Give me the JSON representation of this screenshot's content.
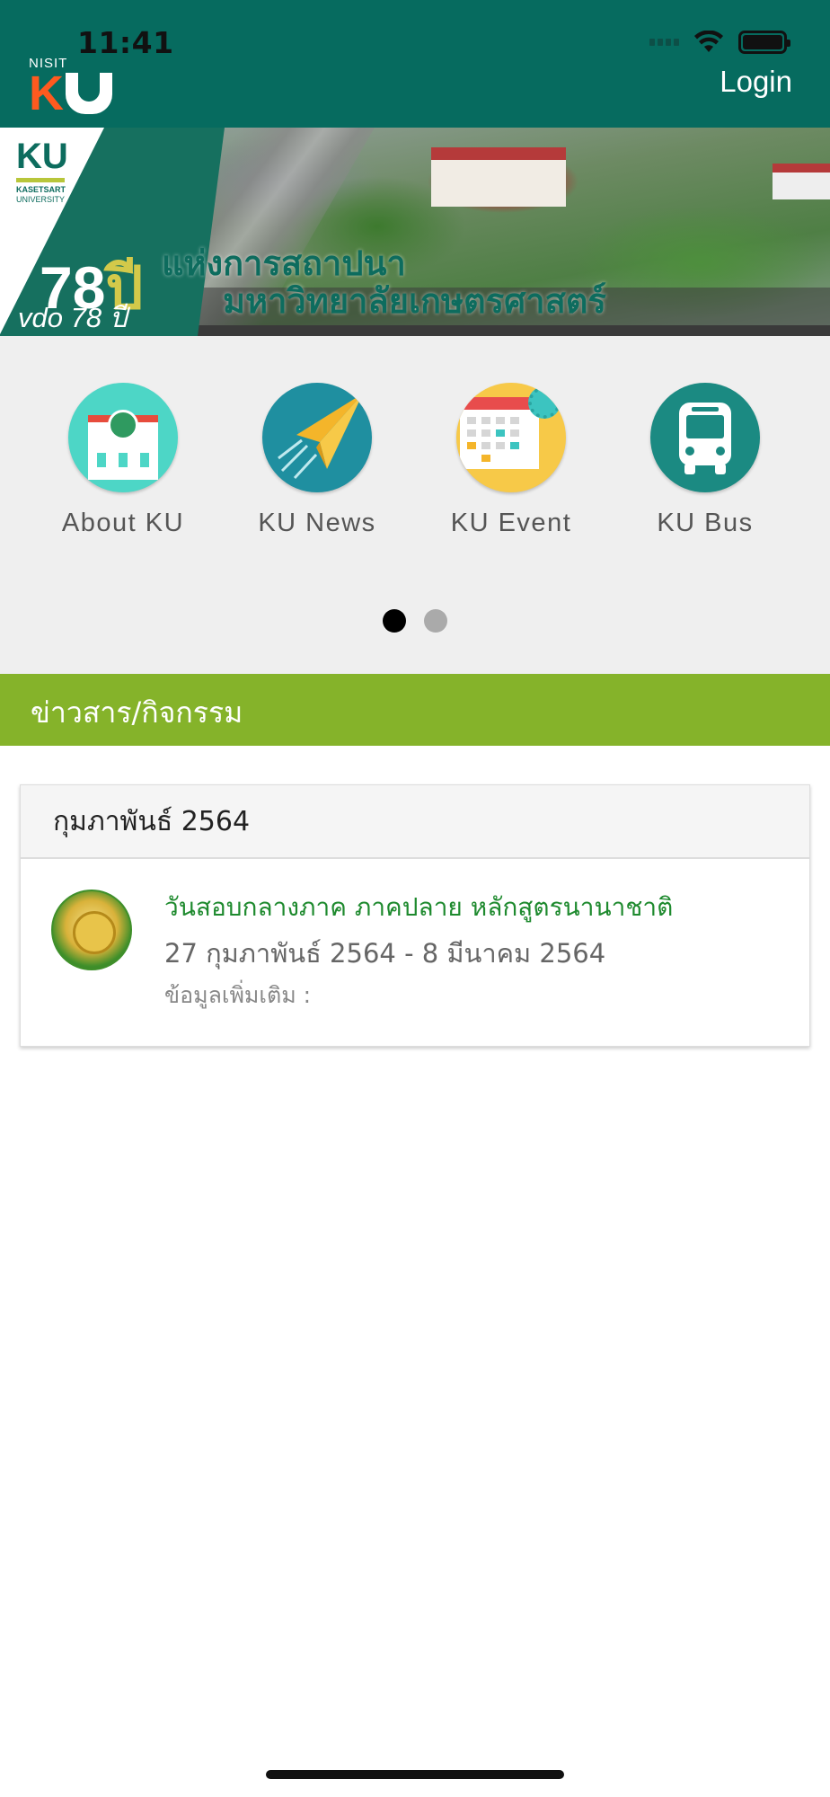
{
  "status_bar": {
    "time": "11:41"
  },
  "header": {
    "logo_small": "NISIT",
    "logo_main": "K",
    "login_label": "Login"
  },
  "banner": {
    "logo_text": "KU",
    "logo_line1": "KASETSART",
    "logo_line2": "UNIVERSITY",
    "anniversary_number": "78",
    "anniversary_unit": "ปี",
    "headline_line1": "แห่งการสถาปนา",
    "headline_line2": "มหาวิทยาลัยเกษตรศาสตร์",
    "caption": "vdo 78 ปี"
  },
  "menu": {
    "items": [
      {
        "label": "About KU",
        "icon": "building-icon"
      },
      {
        "label": "KU News",
        "icon": "paper-plane-icon"
      },
      {
        "label": "KU Event",
        "icon": "calendar-icon"
      },
      {
        "label": "KU Bus",
        "icon": "bus-icon"
      }
    ],
    "pager": {
      "pages": 2,
      "current": 1
    }
  },
  "news_section": {
    "title": "ข่าวสาร/กิจกรรม"
  },
  "events": {
    "month": "กุมภาพันธ์ 2564",
    "items": [
      {
        "title": "วันสอบกลางภาค ภาคปลาย หลักสูตรนานาชาติ",
        "date_range": "27 กุมภาพันธ์ 2564 - 8 มีนาคม 2564",
        "more": "ข้อมูลเพิ่มเติม :"
      }
    ]
  },
  "colors": {
    "header_bg": "#066b5f",
    "news_bar": "#85b32a",
    "event_title": "#1e8a2e"
  }
}
